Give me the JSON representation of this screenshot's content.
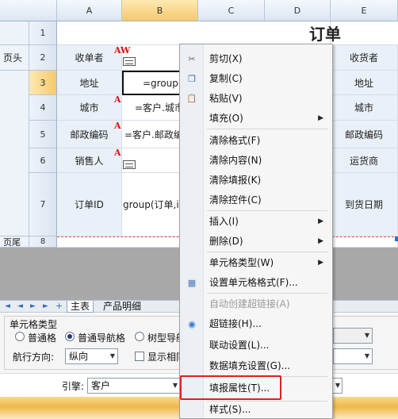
{
  "columns": [
    "A",
    "B",
    "C",
    "D",
    "E"
  ],
  "rows": [
    "1",
    "2",
    "3",
    "4",
    "5",
    "6",
    "7",
    "8"
  ],
  "sections": {
    "header": "页头",
    "footer": "页尾"
  },
  "cells": {
    "r1_title": "订单",
    "r2": {
      "a": "收单者",
      "e": "收货者"
    },
    "r3": {
      "a": "地址",
      "b": "=group(",
      "e": "地址"
    },
    "r4": {
      "a": "城市",
      "b": "=客户.城市",
      "e": "城市"
    },
    "r5": {
      "a": "邮政编码",
      "b": "=客户.邮政编",
      "e": "邮政编码"
    },
    "r6": {
      "a": "销售人",
      "e": "运货商"
    },
    "r7": {
      "a": "订单ID",
      "b": "group(订单,i",
      "e": "到货日期"
    }
  },
  "flags": {
    "aw": "AW",
    "a": "A"
  },
  "context_menu": [
    {
      "label": "剪切(X)",
      "icon": "scissors-icon",
      "glyph": "✂"
    },
    {
      "label": "复制(C)",
      "icon": "copy-icon",
      "glyph": "❐"
    },
    {
      "label": "粘贴(V)",
      "icon": "paste-icon",
      "glyph": "📋"
    },
    {
      "label": "填充(O)",
      "submenu": true
    },
    {
      "label": "清除格式(F)"
    },
    {
      "label": "清除内容(N)"
    },
    {
      "label": "清除填报(K)"
    },
    {
      "label": "清除控件(C)"
    },
    {
      "label": "插入(I)",
      "submenu": true
    },
    {
      "label": "删除(D)",
      "submenu": true
    },
    {
      "label": "单元格类型(W)",
      "submenu": true
    },
    {
      "label": "设置单元格格式(F)...",
      "icon": "format-cells-icon",
      "glyph": "▦"
    },
    {
      "label": "自动创建超链接(A)",
      "disabled": true
    },
    {
      "label": "超链接(H)...",
      "icon": "globe-icon",
      "glyph": "◉"
    },
    {
      "label": "联动设置(L)..."
    },
    {
      "label": "数据填充设置(G)..."
    },
    {
      "label": "填报属性(T)...",
      "highlighted": true
    },
    {
      "label": "样式(S)..."
    }
  ],
  "sheet_tabs": {
    "nav": [
      "◄",
      "◄",
      "►",
      "►",
      "+"
    ],
    "tabs": [
      "主表",
      "产品明细"
    ]
  },
  "panel": {
    "cell_type_title": "单元格类型",
    "radios": [
      {
        "label": "普通格",
        "checked": false
      },
      {
        "label": "普通导航格",
        "checked": true
      },
      {
        "label": "树型导航",
        "checked": false
      }
    ],
    "direction_label": "航行方向:",
    "direction_value": "纵向",
    "show_label": "显示相同",
    "engine_label": "引擎:",
    "engine_value": "客户"
  },
  "colors": {
    "accent_border": "#e02020",
    "header_gradient": "#dce6f2",
    "selection": "#f6c96b"
  }
}
